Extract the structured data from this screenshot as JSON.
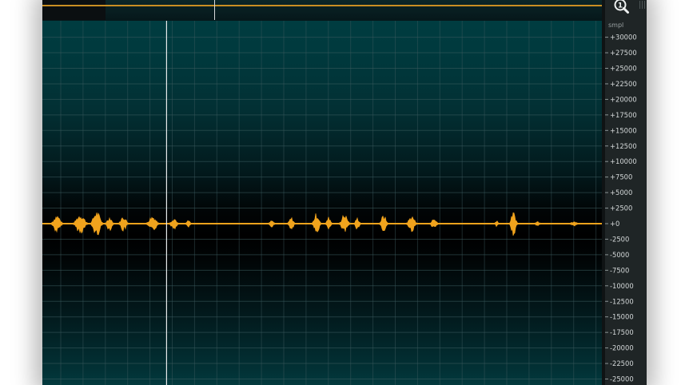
{
  "overview": {
    "playhead_fraction": 0.306,
    "viewport_fraction": 0.112
  },
  "waveform": {
    "playhead_time_fraction": 0.222,
    "colors": {
      "wave": "#f0a31d",
      "grid": "#3d5c5f",
      "playhead": "#e6e9ea",
      "ruler_background": "#1f2526",
      "ruler_text": "#d4d8d9"
    },
    "bursts": [
      {
        "center": 0.026,
        "width": 0.022,
        "amp": 9
      },
      {
        "center": 0.068,
        "width": 0.028,
        "amp": 10
      },
      {
        "center": 0.097,
        "width": 0.024,
        "amp": 13
      },
      {
        "center": 0.12,
        "width": 0.016,
        "amp": 7
      },
      {
        "center": 0.145,
        "width": 0.018,
        "amp": 8
      },
      {
        "center": 0.197,
        "width": 0.024,
        "amp": 8
      },
      {
        "center": 0.235,
        "width": 0.017,
        "amp": 6
      },
      {
        "center": 0.261,
        "width": 0.01,
        "amp": 3
      },
      {
        "center": 0.41,
        "width": 0.012,
        "amp": 3
      },
      {
        "center": 0.445,
        "width": 0.014,
        "amp": 6
      },
      {
        "center": 0.49,
        "width": 0.017,
        "amp": 11
      },
      {
        "center": 0.512,
        "width": 0.012,
        "amp": 7
      },
      {
        "center": 0.54,
        "width": 0.02,
        "amp": 10
      },
      {
        "center": 0.563,
        "width": 0.012,
        "amp": 6
      },
      {
        "center": 0.61,
        "width": 0.016,
        "amp": 9
      },
      {
        "center": 0.66,
        "width": 0.02,
        "amp": 8
      },
      {
        "center": 0.7,
        "width": 0.016,
        "amp": 5
      },
      {
        "center": 0.812,
        "width": 0.007,
        "amp": 4
      },
      {
        "center": 0.842,
        "width": 0.016,
        "amp": 12
      },
      {
        "center": 0.885,
        "width": 0.01,
        "amp": 2
      },
      {
        "center": 0.95,
        "width": 0.015,
        "amp": 2
      }
    ]
  },
  "ruler": {
    "unit": "smpl",
    "zoom_icon": "magnifier-zoom-icon",
    "ticks": [
      {
        "label": "+30000",
        "value": 30000
      },
      {
        "label": "+27500",
        "value": 27500
      },
      {
        "label": "+25000",
        "value": 25000
      },
      {
        "label": "+22500",
        "value": 22500
      },
      {
        "label": "+20000",
        "value": 20000
      },
      {
        "label": "+17500",
        "value": 17500
      },
      {
        "label": "+15000",
        "value": 15000
      },
      {
        "label": "+12500",
        "value": 12500
      },
      {
        "label": "+10000",
        "value": 10000
      },
      {
        "label": "+7500",
        "value": 7500
      },
      {
        "label": "+5000",
        "value": 5000
      },
      {
        "label": "+2500",
        "value": 2500
      },
      {
        "label": "+0",
        "value": 0
      },
      {
        "label": "-2500",
        "value": -2500
      },
      {
        "label": "-5000",
        "value": -5000
      },
      {
        "label": "-7500",
        "value": -7500
      },
      {
        "label": "-10000",
        "value": -10000
      },
      {
        "label": "-12500",
        "value": -12500
      },
      {
        "label": "-15000",
        "value": -15000
      },
      {
        "label": "-17500",
        "value": -17500
      },
      {
        "label": "-20000",
        "value": -20000
      },
      {
        "label": "-22500",
        "value": -22500
      },
      {
        "label": "-25000",
        "value": -25000
      }
    ]
  }
}
